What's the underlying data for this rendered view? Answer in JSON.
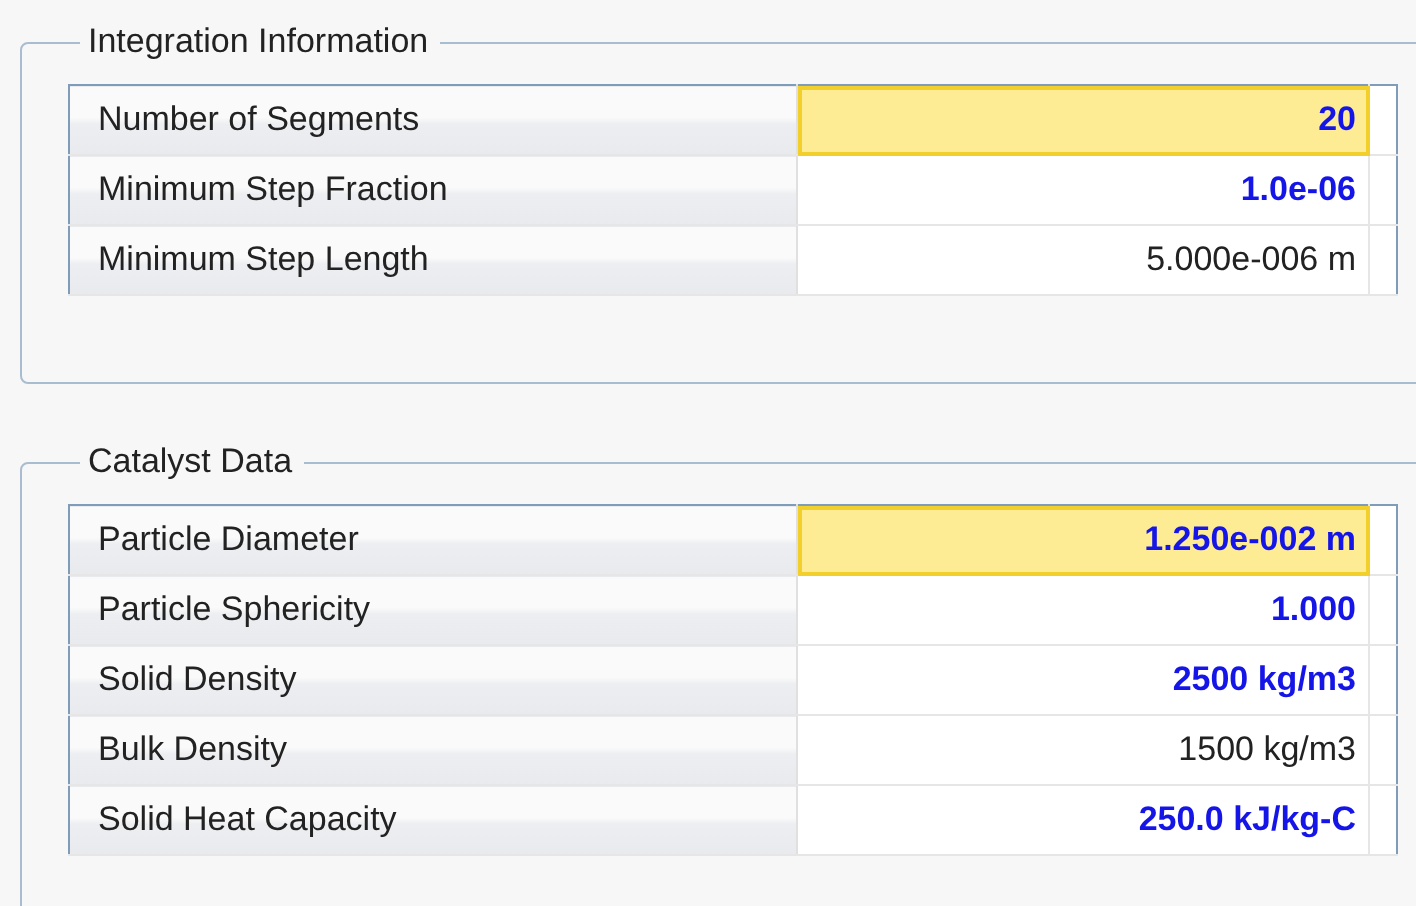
{
  "groups": [
    {
      "title": "Integration Information",
      "rows": [
        {
          "label": "Number of Segments",
          "value": "20",
          "kind": "specified",
          "selected": true
        },
        {
          "label": "Minimum Step Fraction",
          "value": "1.0e-06",
          "kind": "specified",
          "selected": false
        },
        {
          "label": "Minimum Step Length",
          "value": "5.000e-006 m",
          "kind": "calculated",
          "selected": false
        }
      ]
    },
    {
      "title": "Catalyst Data",
      "rows": [
        {
          "label": "Particle Diameter",
          "value": "1.250e-002 m",
          "kind": "specified",
          "selected": true
        },
        {
          "label": "Particle Sphericity",
          "value": "1.000",
          "kind": "specified",
          "selected": false
        },
        {
          "label": "Solid Density",
          "value": "2500 kg/m3",
          "kind": "specified",
          "selected": false
        },
        {
          "label": "Bulk Density",
          "value": "1500 kg/m3",
          "kind": "calculated",
          "selected": false
        },
        {
          "label": "Solid Heat Capacity",
          "value": "250.0 kJ/kg-C",
          "kind": "specified",
          "selected": false
        }
      ]
    }
  ]
}
